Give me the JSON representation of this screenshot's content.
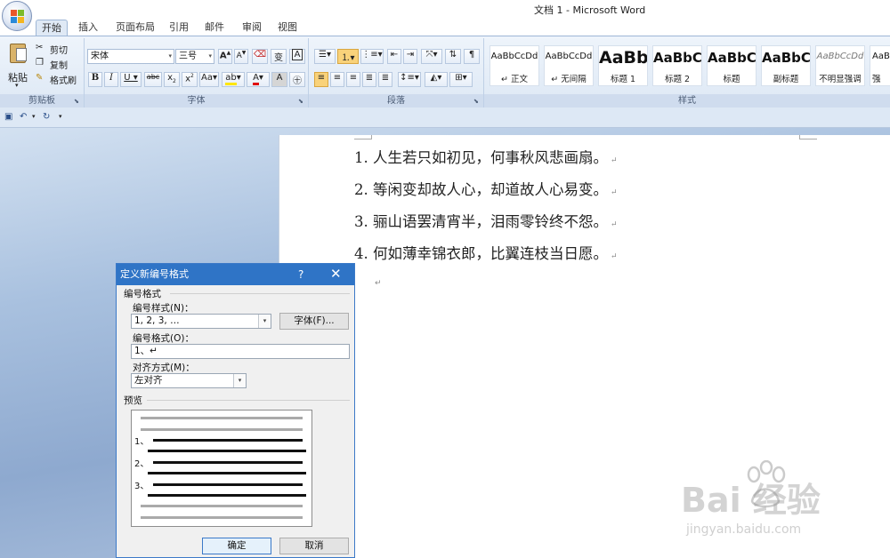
{
  "window": {
    "title": "文档 1 - Microsoft Word"
  },
  "tabs": [
    {
      "label": "开始",
      "active": true
    },
    {
      "label": "插入"
    },
    {
      "label": "页面布局"
    },
    {
      "label": "引用"
    },
    {
      "label": "邮件"
    },
    {
      "label": "审阅"
    },
    {
      "label": "视图"
    }
  ],
  "ribbon": {
    "clipboard": {
      "paste": "粘贴",
      "cut": "剪切",
      "copy": "复制",
      "format_painter": "格式刷",
      "label": "剪贴板"
    },
    "font": {
      "name": "宋体",
      "size": "三号",
      "label": "字体",
      "aa_label": "Aa",
      "a_label": "A"
    },
    "paragraph": {
      "label": "段落"
    },
    "styles": {
      "label": "样式",
      "items": [
        {
          "sample": "AaBbCcDd",
          "name": "↵ 正文"
        },
        {
          "sample": "AaBbCcDd",
          "name": "↵ 无间隔"
        },
        {
          "sample": "AaBb",
          "name": "标题 1"
        },
        {
          "sample": "AaBbC",
          "name": "标题 2"
        },
        {
          "sample": "AaBbC",
          "name": "标题"
        },
        {
          "sample": "AaBbC",
          "name": "副标题"
        },
        {
          "sample": "AaBbCcDd",
          "name": "不明显强调"
        },
        {
          "sample": "AaB",
          "name": "强"
        }
      ]
    }
  },
  "document": {
    "lines": [
      "1. 人生若只如初见，何事秋风悲画扇。",
      "2. 等闲变却故人心，却道故人心易变。",
      "3. 骊山语罢清宵半，泪雨零铃终不怨。",
      "4. 何如薄幸锦衣郎，比翼连枝当日愿。"
    ],
    "para_mark": "↵"
  },
  "dialog": {
    "title": "定义新编号格式",
    "help": "?",
    "close": "✕",
    "section_number_format": "编号格式",
    "style_label": "编号样式(N)：",
    "style_value": "1, 2, 3, …",
    "font_button": "字体(F)...",
    "format_label": "编号格式(O)：",
    "format_value": "1、↵",
    "align_label": "对齐方式(M)：",
    "align_value": "左对齐",
    "preview_label": "预览",
    "preview_numbers": [
      "1、",
      "2、",
      "3、"
    ],
    "ok": "确定",
    "cancel": "取消"
  },
  "watermark": {
    "brand": "Bai  经验",
    "url": "jingyan.baidu.com"
  },
  "colors": {
    "dialog_title_bg": "#2f74c6",
    "ribbon_bg": "#dde8f5",
    "workspace": "#a9c1df"
  }
}
